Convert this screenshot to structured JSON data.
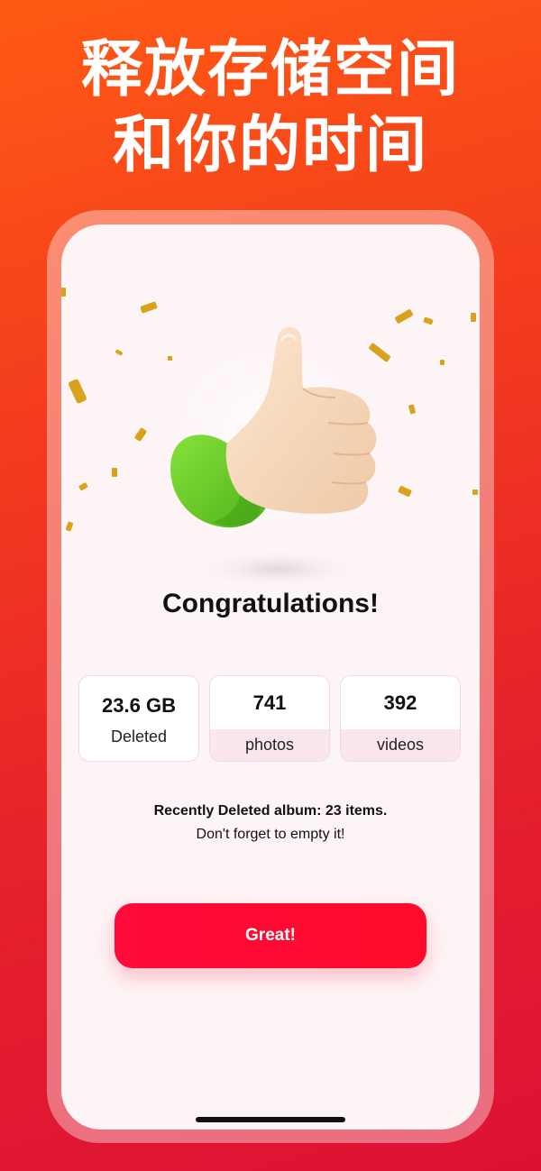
{
  "headline": {
    "line1": "释放存储空间",
    "line2": "和你的时间"
  },
  "screen": {
    "title": "Congratulations!",
    "stats": [
      {
        "value": "23.6 GB",
        "label": "Deleted"
      },
      {
        "value": "741",
        "label": "photos"
      },
      {
        "value": "392",
        "label": "videos"
      }
    ],
    "note_line1": "Recently Deleted album: 23 items.",
    "note_line2": "Don't forget to empty it!",
    "button_label": "Great!"
  },
  "colors": {
    "background_top": "#ff5a14",
    "background_bottom": "#dc1235",
    "screen_bg": "#fdf4f6",
    "button": "#ff0a3a",
    "sleeve": "#6fd12a",
    "confetti": "#d9a21b"
  },
  "icons": {
    "illustration": "thumbs-up-illustration",
    "confetti": "confetti-icon"
  }
}
